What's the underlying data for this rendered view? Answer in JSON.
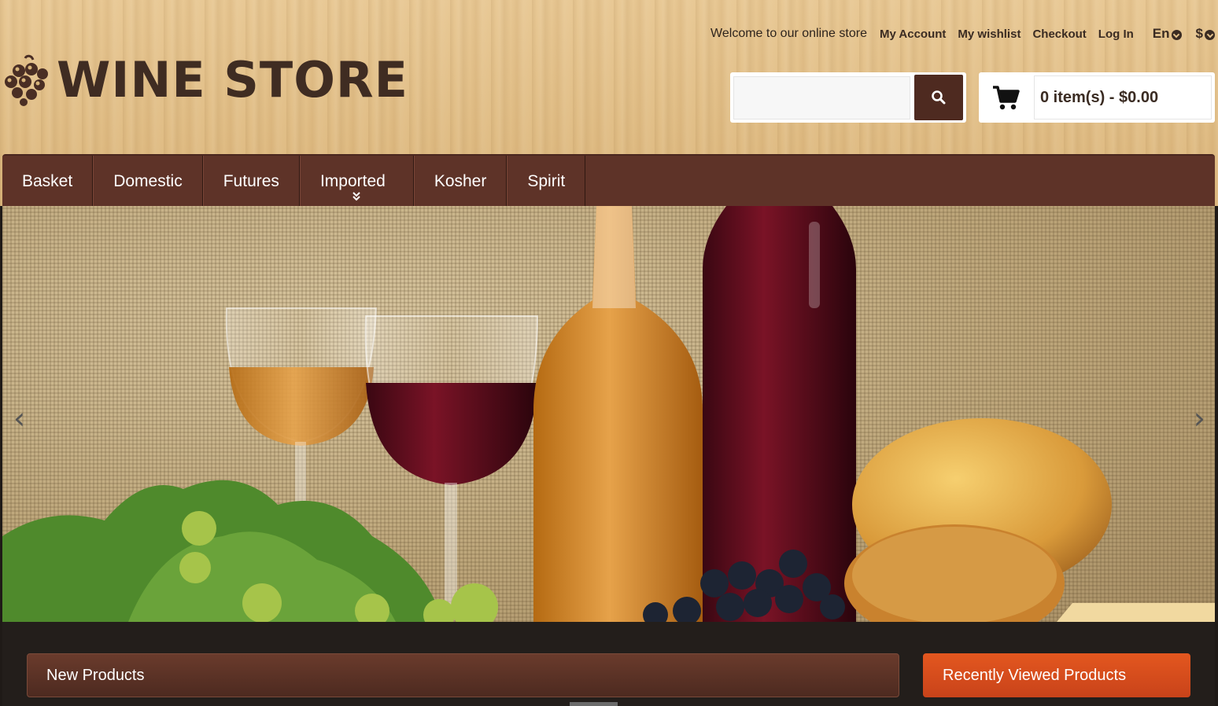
{
  "topbar": {
    "welcome": "Welcome to our online store",
    "links": [
      "My Account",
      "My wishlist",
      "Checkout",
      "Log In"
    ],
    "language": "En",
    "currency": "$"
  },
  "logo": {
    "text": "WINE STORE"
  },
  "search": {
    "placeholder": ""
  },
  "cart": {
    "summary": "0 item(s) - $0.00"
  },
  "nav": {
    "items": [
      {
        "label": "Basket"
      },
      {
        "label": "Domestic"
      },
      {
        "label": "Futures"
      },
      {
        "label": "Imported"
      },
      {
        "label": "Kosher"
      },
      {
        "label": "Spirit"
      }
    ]
  },
  "slider": {
    "prev_label": "‹",
    "next_label": "›"
  },
  "sections": {
    "new_products": "New Products",
    "recently_viewed": "Recently Viewed Products"
  },
  "colors": {
    "brand_brown": "#5e3328",
    "accent_orange": "#e3571f",
    "wood": "#e2c08a"
  },
  "icons": {
    "logo": "grape-cluster-icon",
    "search": "search-icon",
    "cart": "shopping-cart-icon",
    "dropdown": "chevron-down-circle-icon",
    "submenu": "double-chevron-down-icon"
  }
}
